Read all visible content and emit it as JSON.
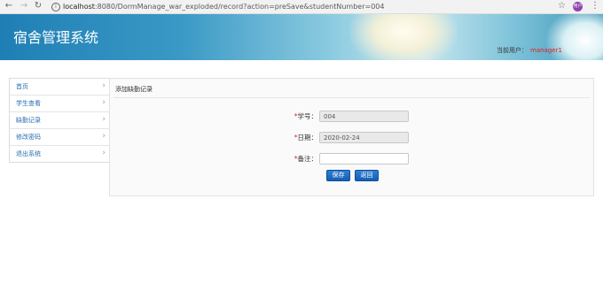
{
  "browser": {
    "url_host": "localhost",
    "url_rest": ":8080/DormManage_war_exploded/record?action=preSave&studentNumber=004",
    "avatar_text": "用户",
    "icons": [
      "back-arrow-icon",
      "forward-arrow-icon",
      "reload-icon",
      "info-icon",
      "star-icon",
      "menu-icon"
    ]
  },
  "header": {
    "title": "宿舍管理系统",
    "user_label": "当前用户：",
    "user_name": "manager1"
  },
  "sidebar": {
    "items": [
      {
        "label": "首页"
      },
      {
        "label": "学生查看"
      },
      {
        "label": "缺勤记录"
      },
      {
        "label": "修改密码"
      },
      {
        "label": "退出系统"
      }
    ]
  },
  "form": {
    "title": "添加缺勤记录",
    "required_mark": "*",
    "student_number_label": "学号：",
    "student_number_value": "004",
    "date_label": "日期：",
    "date_value": "2020-02-24",
    "remark_label": "备注：",
    "remark_value": "",
    "save_label": "保存",
    "back_label": "返回"
  },
  "colors": {
    "link": "#2a6fb0",
    "required": "#e02020",
    "button": "#145fb5"
  }
}
